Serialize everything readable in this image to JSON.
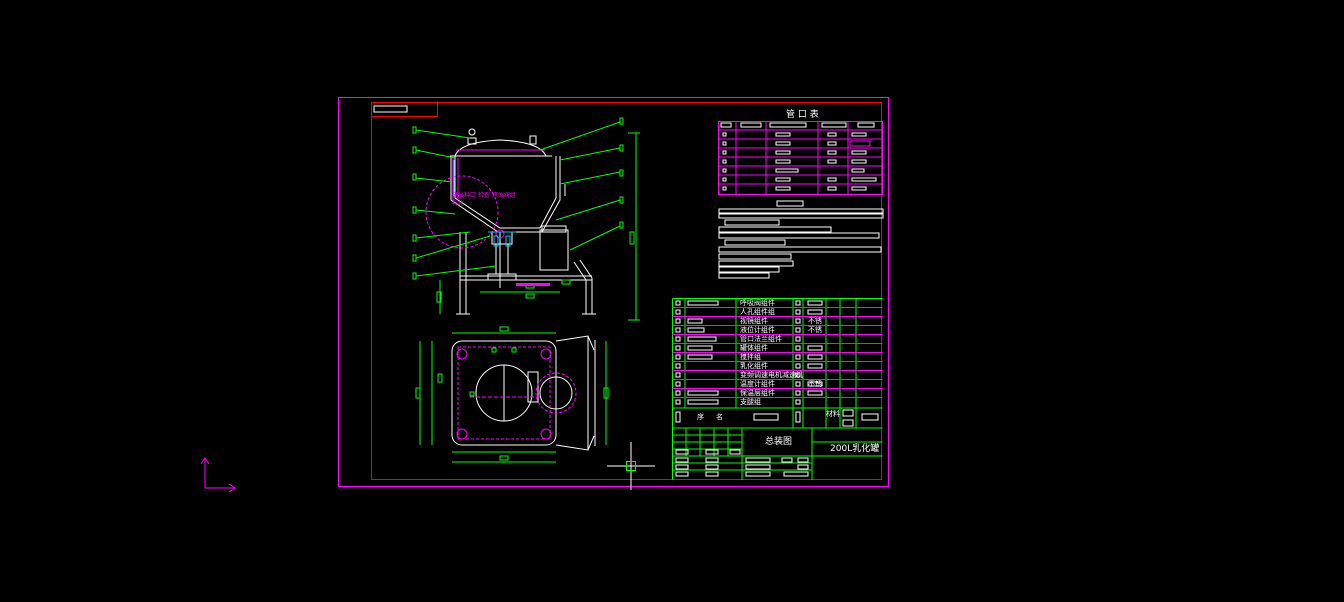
{
  "drawing": {
    "product_name": "200L乳化罐",
    "sheet_title": "总装图",
    "nozzle_table_title": "管 口 表",
    "mixer_label": "乳化",
    "ucs_icon": "ucs-axis-icon",
    "colors": {
      "background": "#000000",
      "border": "#ff00ff",
      "frame": "#ff0000",
      "geometry": "#ffffff",
      "dimension": "#00ff00",
      "highlight": "#ff00ff",
      "crosshair": "#ffffff"
    }
  },
  "parts_list": {
    "rows": [
      {
        "name": "呼吸阀组件",
        "material": ""
      },
      {
        "name": "人孔组件组",
        "material": ""
      },
      {
        "name": "视镜组件",
        "material": "不锈"
      },
      {
        "name": "液位计组件",
        "material": "不锈"
      },
      {
        "name": "管口法兰组件",
        "material": ""
      },
      {
        "name": "罐体组件",
        "material": ""
      },
      {
        "name": "搅拌组",
        "material": ""
      },
      {
        "name": "乳化组件",
        "material": ""
      },
      {
        "name": "变频调速电机减速机",
        "material": ""
      },
      {
        "name": "温度计组件",
        "material": "不锈"
      },
      {
        "name": "保温层组件",
        "material": ""
      },
      {
        "name": "支腿组",
        "material": ""
      }
    ],
    "header_left": "序",
    "header_mid": "名",
    "header_material": "材料"
  }
}
